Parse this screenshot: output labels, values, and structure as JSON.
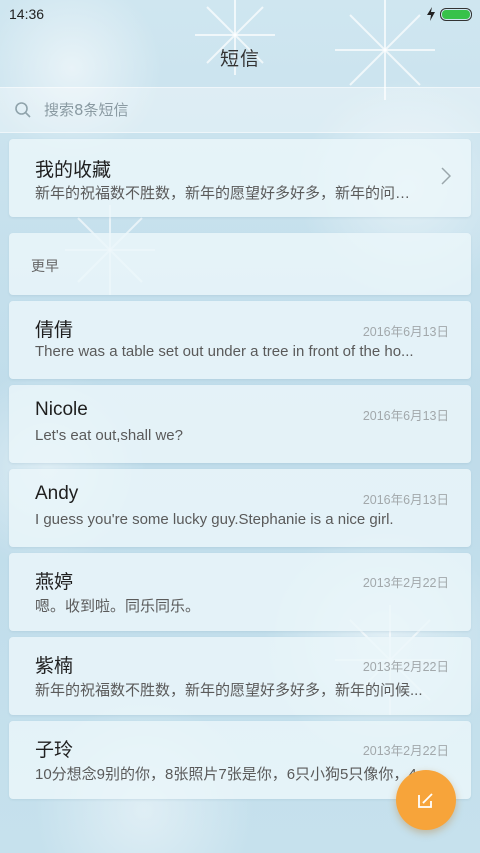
{
  "status": {
    "time": "14:36"
  },
  "header": {
    "title": "短信"
  },
  "search": {
    "placeholder": "搜索8条短信"
  },
  "favorites": {
    "title": "我的收藏",
    "preview": "新年的祝福数不胜数，新年的愿望好多好多，新年的问候..."
  },
  "section": {
    "earlier_label": "更早"
  },
  "messages": [
    {
      "name": "倩倩",
      "date": "2016年6月13日",
      "preview": "There was a table set out under a tree in front of the ho..."
    },
    {
      "name": "Nicole",
      "date": "2016年6月13日",
      "preview": "Let's eat out,shall we?"
    },
    {
      "name": "Andy",
      "date": "2016年6月13日",
      "preview": "I guess you're some lucky guy.Stephanie is a nice girl."
    },
    {
      "name": "燕婷",
      "date": "2013年2月22日",
      "preview": "嗯。收到啦。同乐同乐。"
    },
    {
      "name": "紫楠",
      "date": "2013年2月22日",
      "preview": "新年的祝福数不胜数，新年的愿望好多好多，新年的问候..."
    },
    {
      "name": "子玲",
      "date": "2013年2月22日",
      "preview": "10分想念9别的你，8张照片7张是你，6只小狗5只像你，4..."
    }
  ],
  "colors": {
    "accent": "#f7a43a",
    "battery": "#37c24a"
  },
  "icons": {
    "search": "search-icon",
    "chevron": "chevron-right-icon",
    "compose": "compose-icon",
    "charging": "charging-icon"
  }
}
